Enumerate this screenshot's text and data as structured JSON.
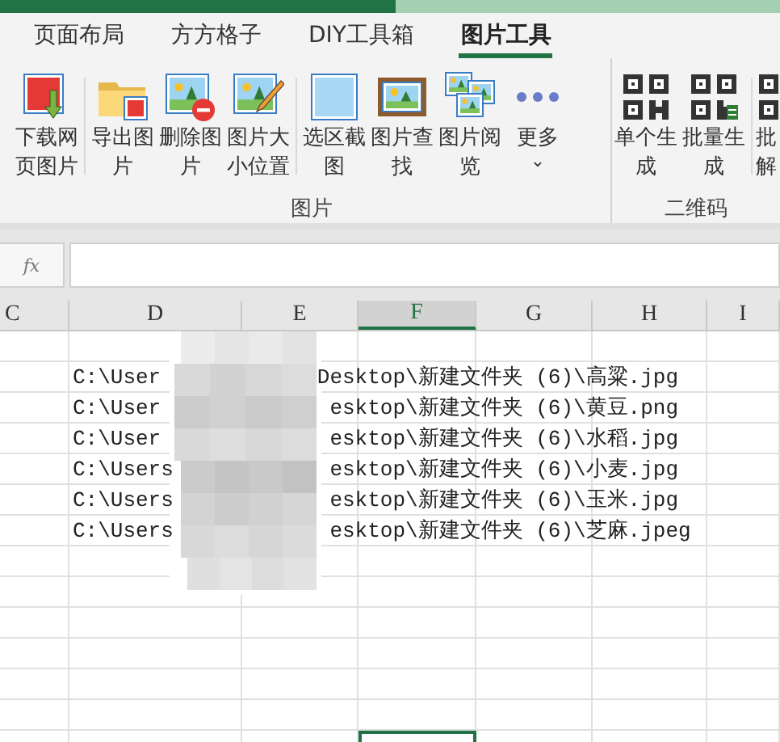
{
  "tabs": [
    {
      "label": "页面布局",
      "selected": false
    },
    {
      "label": "方方格子",
      "selected": false
    },
    {
      "label": "DIY工具箱",
      "selected": false
    },
    {
      "label": "图片工具",
      "selected": true
    }
  ],
  "ribbon_groups": [
    {
      "label": "图片",
      "buttons": [
        {
          "label": "下载网页图片"
        },
        {
          "label": "导出图片"
        },
        {
          "label": "删除图片"
        },
        {
          "label": "图片大小位置"
        },
        {
          "label": "选区截图"
        },
        {
          "label": "图片查找"
        },
        {
          "label": "图片阅览"
        },
        {
          "label": "更多",
          "caret": "⌄"
        }
      ]
    },
    {
      "label": "二维码",
      "buttons": [
        {
          "label": "单个生成"
        },
        {
          "label": "批量生成"
        },
        {
          "label": "批解"
        }
      ]
    }
  ],
  "formula_bar": {
    "function_label": "fx"
  },
  "columns": [
    {
      "label": "C",
      "selected": false
    },
    {
      "label": "D",
      "selected": false
    },
    {
      "label": "E",
      "selected": false
    },
    {
      "label": "F",
      "selected": true
    },
    {
      "label": "G",
      "selected": false
    },
    {
      "label": "H",
      "selected": false
    },
    {
      "label": "I",
      "selected": false
    }
  ],
  "rows": [
    {
      "kind": "blank",
      "active": false
    },
    {
      "kind": "path",
      "left": "C:\\User",
      "right": "Desktop\\新建文件夹 (6)\\高粱.jpg",
      "active": false
    },
    {
      "kind": "path",
      "left": "C:\\User",
      "right": "esktop\\新建文件夹 (6)\\黄豆.png",
      "active": false
    },
    {
      "kind": "path",
      "left": "C:\\User",
      "right": "esktop\\新建文件夹 (6)\\水稻.jpg",
      "active": false
    },
    {
      "kind": "path",
      "left": "C:\\Users",
      "right": "esktop\\新建文件夹 (6)\\小麦.jpg",
      "active": false
    },
    {
      "kind": "path",
      "left": "C:\\Users",
      "right": "esktop\\新建文件夹 (6)\\玉米.jpg",
      "active": false
    },
    {
      "kind": "path",
      "left": "C:\\Users",
      "right": "esktop\\新建文件夹 (6)\\芝麻.jpeg",
      "active": false
    },
    {
      "kind": "blank",
      "active": false
    },
    {
      "kind": "blank",
      "active": false
    },
    {
      "kind": "blank",
      "active": false
    },
    {
      "kind": "blank",
      "active": false
    },
    {
      "kind": "blank",
      "active": false
    },
    {
      "kind": "blank",
      "active": false
    },
    {
      "kind": "blank",
      "active": true
    }
  ]
}
